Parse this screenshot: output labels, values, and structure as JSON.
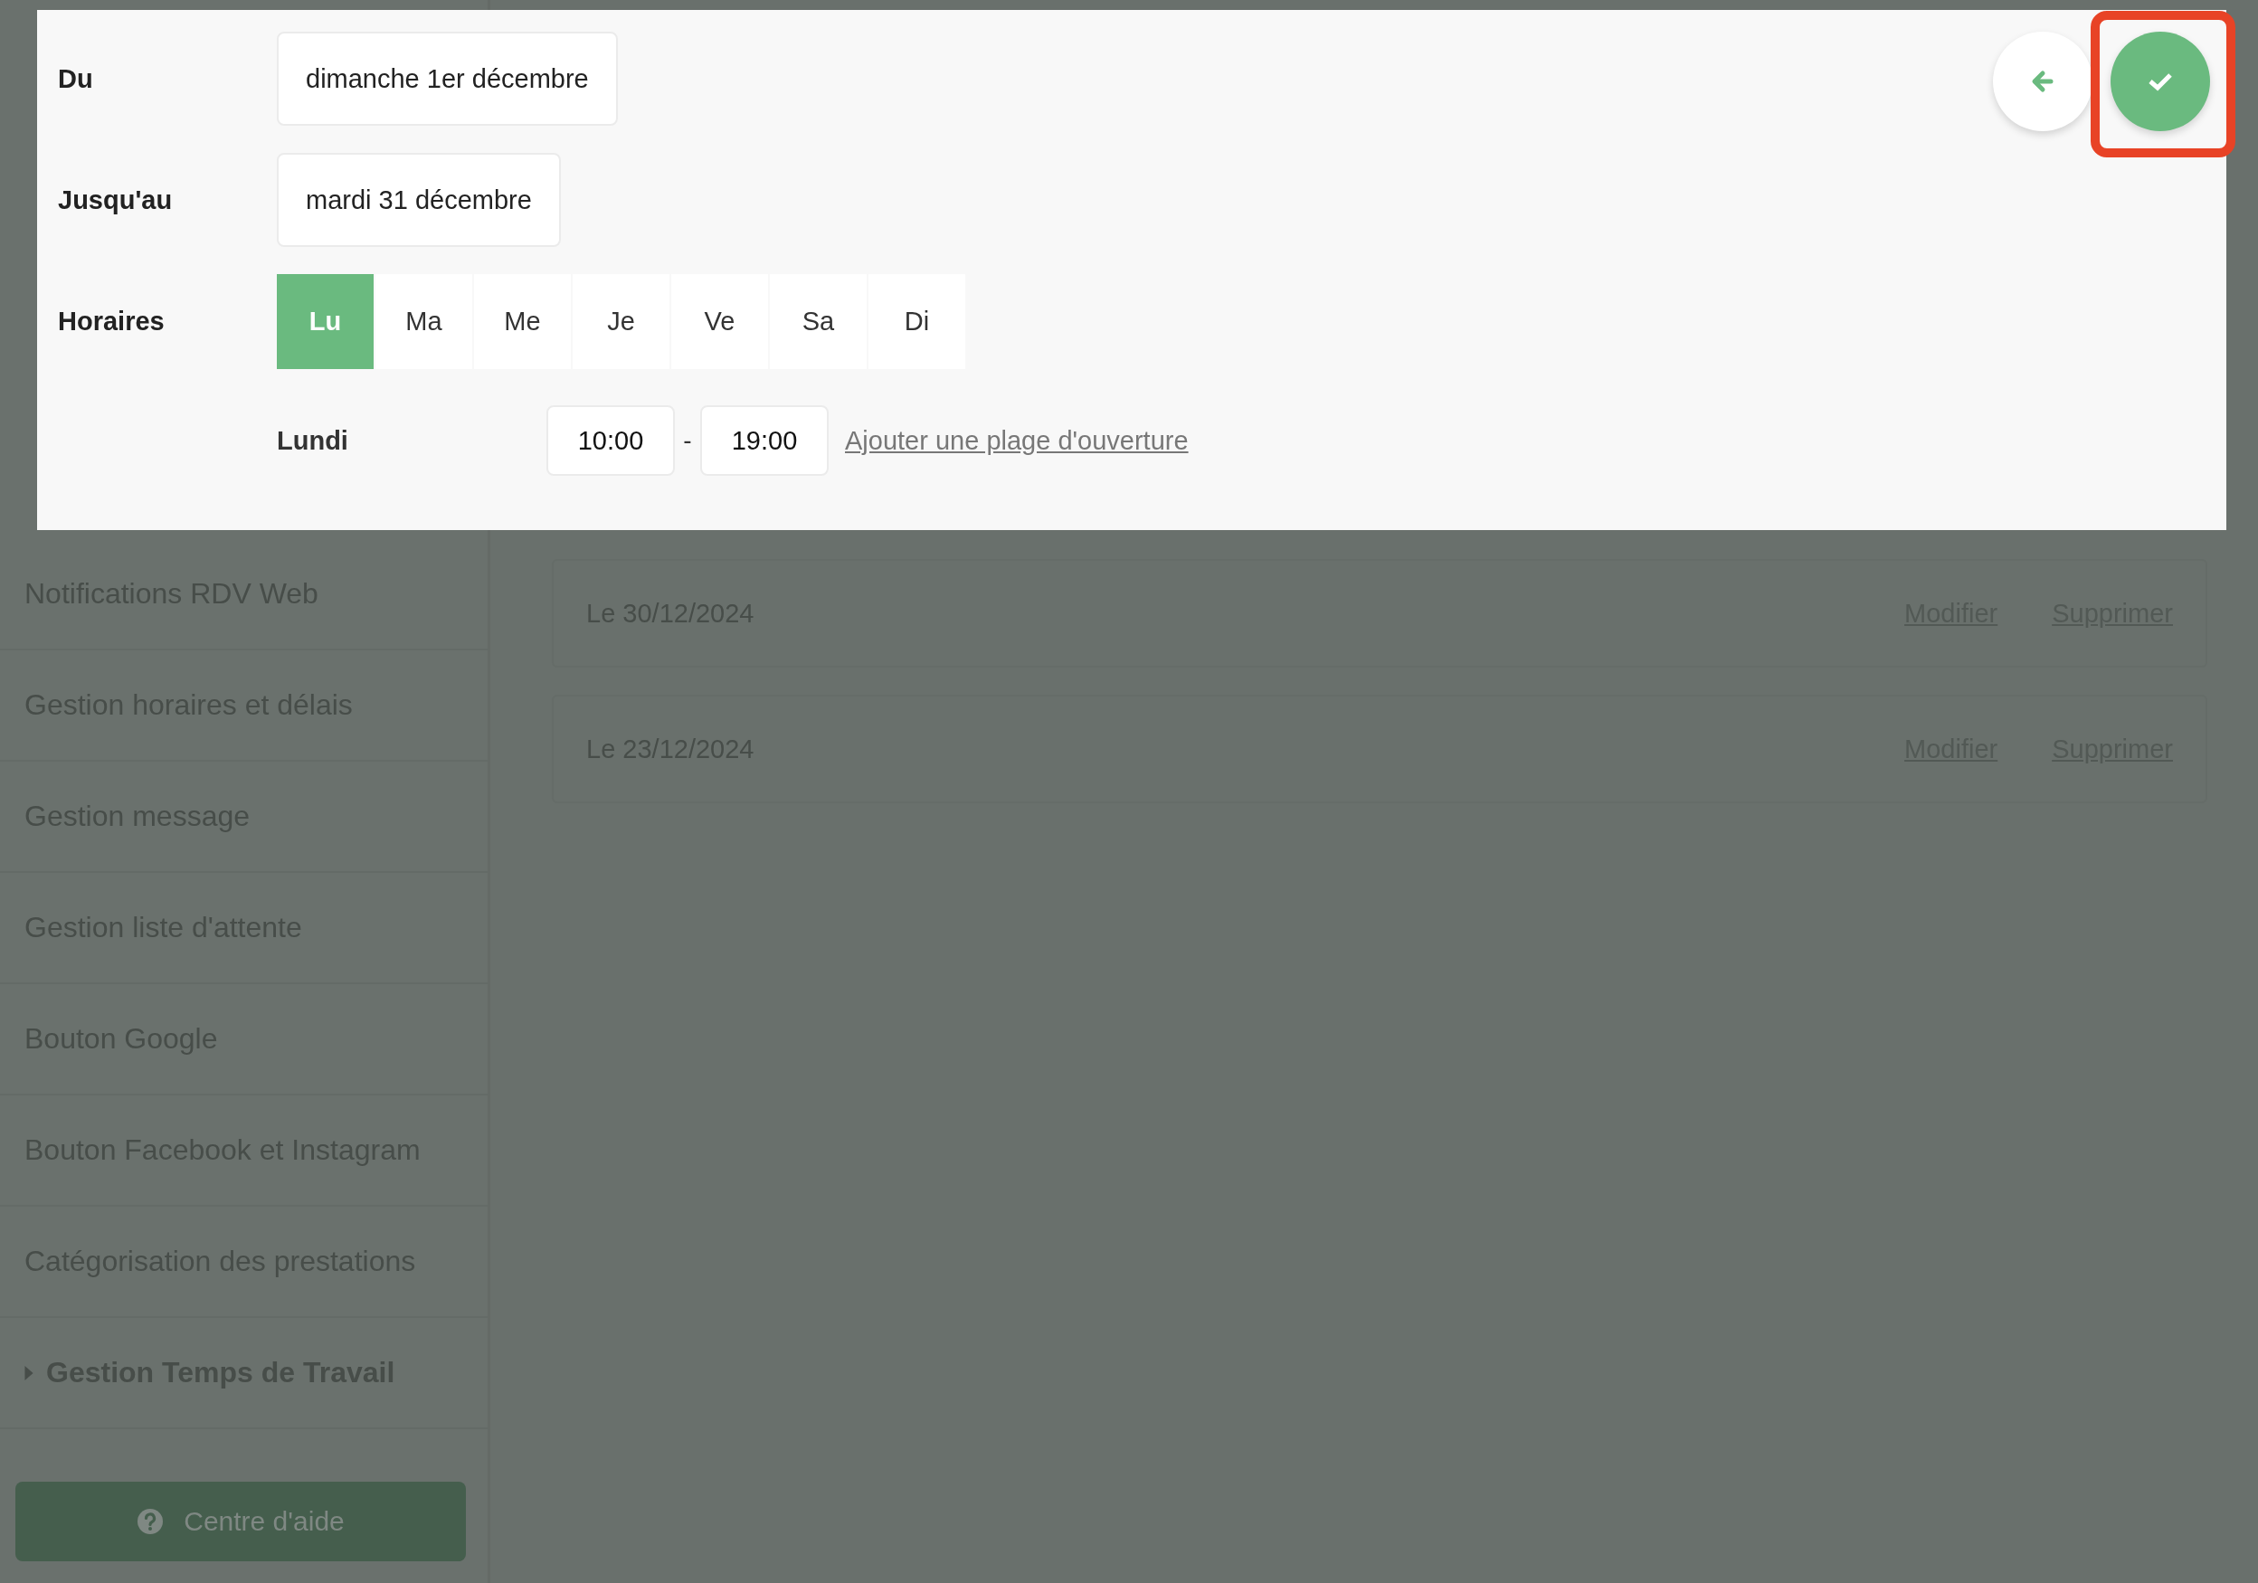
{
  "sidebar": {
    "items": [
      {
        "label": "Notifications RDV Web",
        "kind": "link"
      },
      {
        "label": "Gestion horaires et délais",
        "kind": "link"
      },
      {
        "label": "Gestion message",
        "kind": "link"
      },
      {
        "label": "Gestion liste d'attente",
        "kind": "link"
      },
      {
        "label": "Bouton Google",
        "kind": "link"
      },
      {
        "label": "Bouton Facebook et Instagram",
        "kind": "link"
      },
      {
        "label": "Catégorisation des prestations",
        "kind": "link"
      },
      {
        "label": "Gestion Temps de Travail",
        "kind": "group",
        "expanded": false
      }
    ],
    "help_button": "Centre d'aide"
  },
  "exceptions": [
    {
      "label": "Le 30/12/2024",
      "edit": "Modifier",
      "delete": "Supprimer"
    },
    {
      "label": "Le 23/12/2024",
      "edit": "Modifier",
      "delete": "Supprimer"
    }
  ],
  "dialog": {
    "fields": [
      {
        "label": "Du",
        "value": "dimanche 1er décembre"
      },
      {
        "label": "Jusqu'au",
        "value": "mardi 31 décembre"
      }
    ],
    "schedule": {
      "label": "Horaires",
      "days": [
        {
          "label": "Lu",
          "selected": true
        },
        {
          "label": "Ma",
          "selected": false
        },
        {
          "label": "Me",
          "selected": false
        },
        {
          "label": "Je",
          "selected": false
        },
        {
          "label": "Ve",
          "selected": false
        },
        {
          "label": "Sa",
          "selected": false
        },
        {
          "label": "Di",
          "selected": false
        }
      ],
      "day_name": "Lundi",
      "ranges": [
        {
          "start": "10:00",
          "separator": "-",
          "end": "19:00"
        }
      ],
      "add_link": "Ajouter une plage d'ouverture"
    },
    "confirm_highlighted": true
  }
}
